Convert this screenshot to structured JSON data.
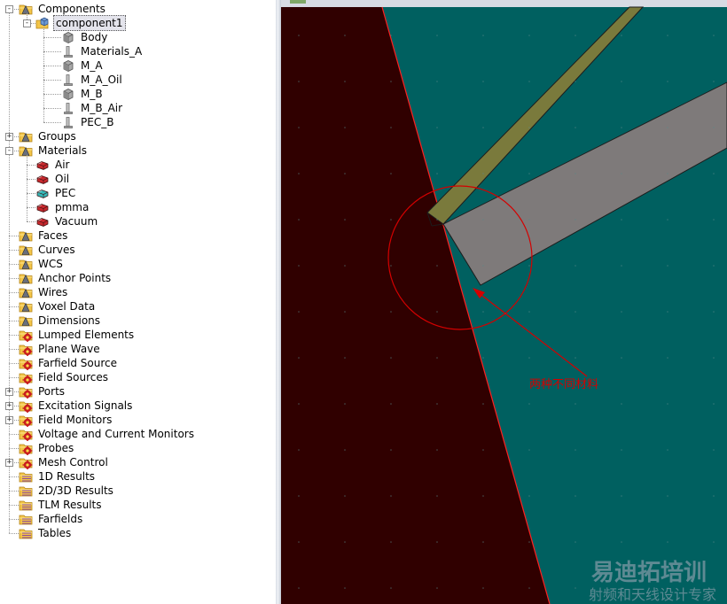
{
  "tree": {
    "components": {
      "label": "Components",
      "children": [
        {
          "label": "component1",
          "selected": true,
          "children": [
            {
              "label": "Body",
              "icon": "solid-cube-icon"
            },
            {
              "label": "Materials_A",
              "icon": "sheet-solid-icon"
            },
            {
              "label": "M_A",
              "icon": "solid-cube-icon"
            },
            {
              "label": "M_A_Oil",
              "icon": "sheet-solid-icon"
            },
            {
              "label": "M_B",
              "icon": "solid-cube-icon"
            },
            {
              "label": "M_B_Air",
              "icon": "sheet-solid-icon"
            },
            {
              "label": "PEC_B",
              "icon": "sheet-solid-icon"
            }
          ]
        }
      ]
    },
    "groups": {
      "label": "Groups"
    },
    "materials": {
      "label": "Materials",
      "children": [
        {
          "label": "Air",
          "color": "#c8282d"
        },
        {
          "label": "Oil",
          "color": "#c8282d"
        },
        {
          "label": "PEC",
          "color": "#35b8b8"
        },
        {
          "label": "pmma",
          "color": "#c8282d"
        },
        {
          "label": "Vacuum",
          "color": "#c8282d"
        }
      ]
    },
    "folders": [
      {
        "label": "Faces",
        "icon": "folder-icon"
      },
      {
        "label": "Curves",
        "icon": "folder-icon"
      },
      {
        "label": "WCS",
        "icon": "folder-icon"
      },
      {
        "label": "Anchor Points",
        "icon": "folder-icon"
      },
      {
        "label": "Wires",
        "icon": "folder-icon"
      },
      {
        "label": "Voxel Data",
        "icon": "folder-icon"
      },
      {
        "label": "Dimensions",
        "icon": "folder-icon"
      },
      {
        "label": "Lumped Elements",
        "icon": "source-folder-icon"
      },
      {
        "label": "Plane Wave",
        "icon": "source-folder-icon"
      },
      {
        "label": "Farfield Source",
        "icon": "source-folder-icon"
      },
      {
        "label": "Field Sources",
        "icon": "source-folder-icon"
      },
      {
        "label": "Ports",
        "icon": "source-folder-icon",
        "expandable": true
      },
      {
        "label": "Excitation Signals",
        "icon": "source-folder-icon",
        "expandable": true
      },
      {
        "label": "Field Monitors",
        "icon": "source-folder-icon",
        "expandable": true
      },
      {
        "label": "Voltage and Current Monitors",
        "icon": "source-folder-icon"
      },
      {
        "label": "Probes",
        "icon": "source-folder-icon"
      },
      {
        "label": "Mesh Control",
        "icon": "source-folder-icon",
        "expandable": true
      },
      {
        "label": "1D Results",
        "icon": "results-folder-icon"
      },
      {
        "label": "2D/3D Results",
        "icon": "results-folder-icon"
      },
      {
        "label": "TLM Results",
        "icon": "results-folder-icon"
      },
      {
        "label": "Farfields",
        "icon": "results-folder-icon"
      },
      {
        "label": "Tables",
        "icon": "results-folder-icon"
      }
    ]
  },
  "viewport": {
    "annotation": "两种不同材料",
    "watermark_title": "易迪拓培训",
    "watermark_subtitle": "射频和天线设计专家",
    "colors": {
      "dark_region": "#300000",
      "teal_region": "#006060",
      "olive_strip": "#7a7a3c",
      "gray_plate": "#7e7a7a",
      "annotation_red": "#d40000"
    }
  }
}
